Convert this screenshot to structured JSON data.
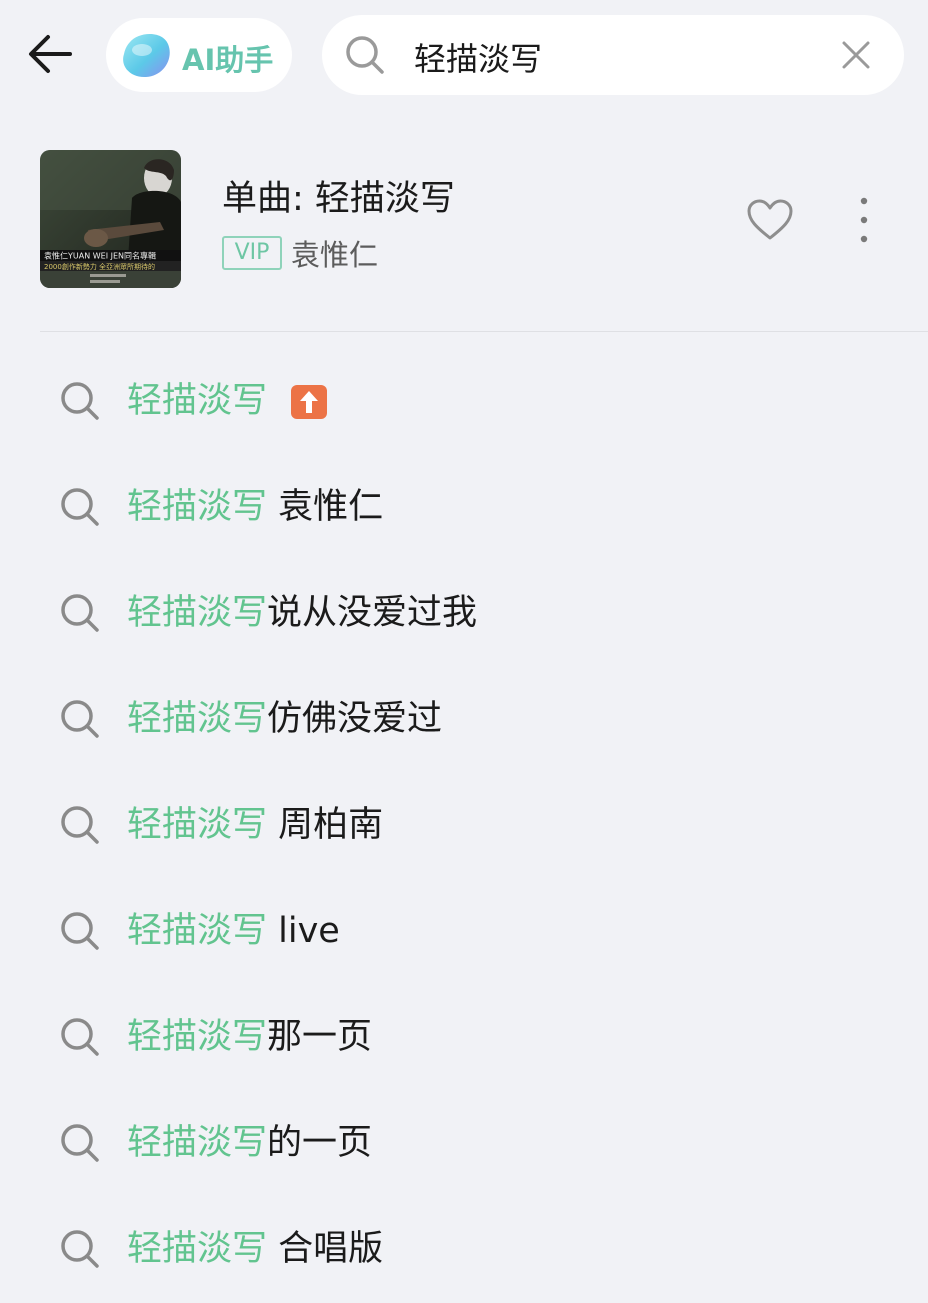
{
  "header": {
    "back_icon": "arrow-left-icon",
    "ai_button_label": "AI助手",
    "search_value": "轻描淡写",
    "clear_icon": "close-icon"
  },
  "song_card": {
    "title": "单曲: 轻描淡写",
    "vip_label": "VIP",
    "artist": "袁惟仁",
    "cover_text_line1": "袁惟仁YUAN WEI JEN同名專輯",
    "cover_text_line2": "2000創作新勢力 全亞洲眾所期待的",
    "favorite_icon": "heart-outline-icon",
    "more_icon": "more-vertical-icon"
  },
  "suggestions": [
    {
      "highlight": "轻描淡写",
      "rest": "",
      "hot": true
    },
    {
      "highlight": "轻描淡写",
      "rest": " 袁惟仁",
      "hot": false
    },
    {
      "highlight": "轻描淡写",
      "rest": "说从没爱过我",
      "hot": false
    },
    {
      "highlight": "轻描淡写",
      "rest": "仿佛没爱过",
      "hot": false
    },
    {
      "highlight": "轻描淡写",
      "rest": " 周柏南",
      "hot": false
    },
    {
      "highlight": "轻描淡写",
      "rest": " live",
      "hot": false
    },
    {
      "highlight": "轻描淡写",
      "rest": "那一页",
      "hot": false
    },
    {
      "highlight": "轻描淡写",
      "rest": "的一页",
      "hot": false
    },
    {
      "highlight": "轻描淡写",
      "rest": " 合唱版",
      "hot": false
    }
  ],
  "colors": {
    "highlight": "#62c48f",
    "ai_accent": "#66c4ae",
    "hot_badge": "#ec7346",
    "background": "#f1f2f6"
  }
}
